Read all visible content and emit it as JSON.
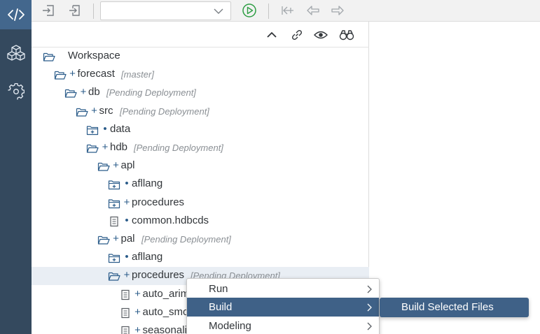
{
  "leftbar": {
    "items": [
      {
        "icon": "code-icon",
        "active": true
      },
      {
        "icon": "cube-stack-icon",
        "active": false
      },
      {
        "icon": "gear-icon",
        "active": false
      }
    ]
  },
  "toolbar": {
    "target_select_value": "",
    "icons": [
      "deploy-in-icon",
      "deploy-out-icon",
      "run-icon",
      "step-back-icon",
      "back-icon",
      "forward-icon"
    ]
  },
  "panel_toolbar": {
    "icons": [
      "collapse-icon",
      "link-icon",
      "eye-icon",
      "binoculars-icon"
    ]
  },
  "tree": [
    {
      "mark": "",
      "name": "Workspace",
      "status": "",
      "icon": "folder-open"
    },
    {
      "mark": "+",
      "name": "forecast",
      "status": "[master]",
      "icon": "folder-open"
    },
    {
      "mark": "+",
      "name": "db",
      "status": "[Pending Deployment]",
      "icon": "folder-open"
    },
    {
      "mark": "+",
      "name": "src",
      "status": "[Pending Deployment]",
      "icon": "folder-open"
    },
    {
      "mark": "•",
      "name": "data",
      "status": "",
      "icon": "folder-plus"
    },
    {
      "mark": "+",
      "name": "hdb",
      "status": "[Pending Deployment]",
      "icon": "folder-open"
    },
    {
      "mark": "+",
      "name": "apl",
      "status": "",
      "icon": "folder-open"
    },
    {
      "mark": "•",
      "name": "afllang",
      "status": "",
      "icon": "folder-plus"
    },
    {
      "mark": "+",
      "name": "procedures",
      "status": "",
      "icon": "folder-plus"
    },
    {
      "mark": "•",
      "name": "common.hdbcds",
      "status": "",
      "icon": "file"
    },
    {
      "mark": "+",
      "name": "pal",
      "status": "[Pending Deployment]",
      "icon": "folder-open"
    },
    {
      "mark": "•",
      "name": "afllang",
      "status": "",
      "icon": "folder-plus"
    },
    {
      "mark": "+",
      "name": "procedures",
      "status": "[Pending Deployment]",
      "icon": "folder-open"
    },
    {
      "mark": "+",
      "name": "auto_arima",
      "status": "",
      "icon": "file"
    },
    {
      "mark": "+",
      "name": "auto_smoothing",
      "status": "",
      "icon": "file"
    },
    {
      "mark": "+",
      "name": "seasonality",
      "status": "",
      "icon": "file"
    }
  ],
  "context_menu": {
    "items": [
      {
        "label": "Run"
      },
      {
        "label": "Build"
      },
      {
        "label": "Modeling"
      }
    ],
    "submenu_label": "Build Selected Files"
  },
  "colors": {
    "sidebar": "#34495e",
    "sidebar_active": "#43678d",
    "menu_highlight": "#3f6187",
    "run_green": "#2e9e44",
    "mark_blue": "#2b5c8a"
  }
}
